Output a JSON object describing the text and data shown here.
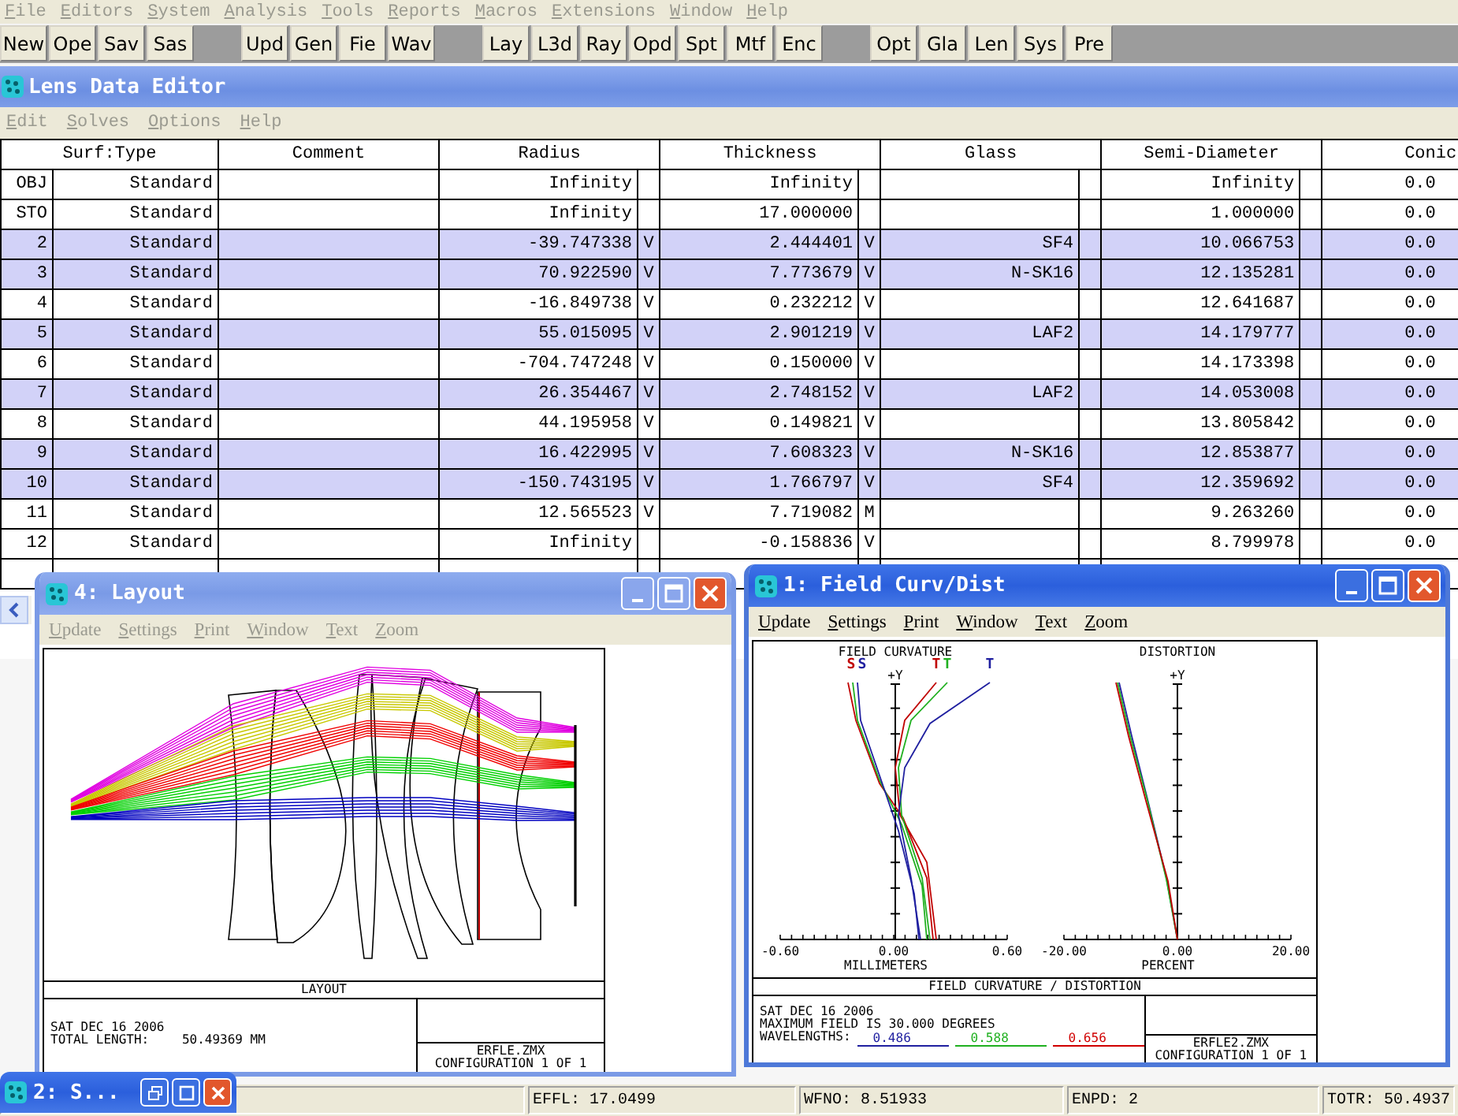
{
  "menu_bar": [
    {
      "label": "File",
      "disabled": true
    },
    {
      "label": "Editors",
      "disabled": true
    },
    {
      "label": "System",
      "disabled": true
    },
    {
      "label": "Analysis",
      "disabled": true
    },
    {
      "label": "Tools",
      "disabled": true
    },
    {
      "label": "Reports",
      "disabled": true
    },
    {
      "label": "Macros",
      "disabled": true
    },
    {
      "label": "Extensions",
      "disabled": true
    },
    {
      "label": "Window",
      "disabled": true
    },
    {
      "label": "Help",
      "disabled": true
    }
  ],
  "toolbar": [
    {
      "buttons": [
        "New",
        "Ope",
        "Sav",
        "Sas"
      ]
    },
    {
      "buttons": [
        "Upd",
        "Gen",
        "Fie",
        "Wav"
      ]
    },
    {
      "buttons": [
        "Lay",
        "L3d",
        "Ray",
        "Opd",
        "Spt",
        "Mtf",
        "Enc"
      ]
    },
    {
      "buttons": [
        "Opt",
        "Gla",
        "Len",
        "Sys",
        "Pre"
      ]
    }
  ],
  "lens_data_editor": {
    "title": "Lens Data Editor",
    "menu": [
      {
        "label": "Edit",
        "disabled": true
      },
      {
        "label": "Solves",
        "disabled": true
      },
      {
        "label": "Options",
        "disabled": true
      },
      {
        "label": "Help",
        "disabled": true
      }
    ],
    "columns": [
      "Surf:Type",
      "Comment",
      "Radius",
      "Thickness",
      "Glass",
      "Semi-Diameter",
      "Conic"
    ],
    "rows": [
      {
        "surf": "OBJ",
        "type": "Standard",
        "radius": "Infinity",
        "thickness": "Infinity",
        "semi_diameter": "Infinity",
        "conic": "0.0",
        "highlighted": false
      },
      {
        "surf": "STO",
        "type": "Standard",
        "radius": "Infinity",
        "thickness": "17.000000",
        "semi_diameter": "1.000000",
        "conic": "0.0",
        "highlighted": false
      },
      {
        "surf": "2",
        "type": "Standard",
        "radius": "-39.747338",
        "radius_solve": "V",
        "thickness": "2.444401",
        "thickness_solve": "V",
        "glass": "SF4",
        "semi_diameter": "10.066753",
        "conic": "0.0",
        "highlighted": true
      },
      {
        "surf": "3",
        "type": "Standard",
        "radius": "70.922590",
        "radius_solve": "V",
        "thickness": "7.773679",
        "thickness_solve": "V",
        "glass": "N-SK16",
        "semi_diameter": "12.135281",
        "conic": "0.0",
        "highlighted": true
      },
      {
        "surf": "4",
        "type": "Standard",
        "radius": "-16.849738",
        "radius_solve": "V",
        "thickness": "0.232212",
        "thickness_solve": "V",
        "semi_diameter": "12.641687",
        "conic": "0.0",
        "highlighted": false
      },
      {
        "surf": "5",
        "type": "Standard",
        "radius": "55.015095",
        "radius_solve": "V",
        "thickness": "2.901219",
        "thickness_solve": "V",
        "glass": "LAF2",
        "semi_diameter": "14.179777",
        "conic": "0.0",
        "highlighted": true
      },
      {
        "surf": "6",
        "type": "Standard",
        "radius": "-704.747248",
        "radius_solve": "V",
        "thickness": "0.150000",
        "thickness_solve": "V",
        "semi_diameter": "14.173398",
        "conic": "0.0",
        "highlighted": false
      },
      {
        "surf": "7",
        "type": "Standard",
        "radius": "26.354467",
        "radius_solve": "V",
        "thickness": "2.748152",
        "thickness_solve": "V",
        "glass": "LAF2",
        "semi_diameter": "14.053008",
        "conic": "0.0",
        "highlighted": true
      },
      {
        "surf": "8",
        "type": "Standard",
        "radius": "44.195958",
        "radius_solve": "V",
        "thickness": "0.149821",
        "thickness_solve": "V",
        "semi_diameter": "13.805842",
        "conic": "0.0",
        "highlighted": false
      },
      {
        "surf": "9",
        "type": "Standard",
        "radius": "16.422995",
        "radius_solve": "V",
        "thickness": "7.608323",
        "thickness_solve": "V",
        "glass": "N-SK16",
        "semi_diameter": "12.853877",
        "conic": "0.0",
        "highlighted": true
      },
      {
        "surf": "10",
        "type": "Standard",
        "radius": "-150.743195",
        "radius_solve": "V",
        "thickness": "1.766797",
        "thickness_solve": "V",
        "glass": "SF4",
        "semi_diameter": "12.359692",
        "conic": "0.0",
        "highlighted": true
      },
      {
        "surf": "11",
        "type": "Standard",
        "radius": "12.565523",
        "radius_solve": "V",
        "thickness": "7.719082",
        "thickness_solve": "M",
        "semi_diameter": "9.263260",
        "conic": "0.0",
        "highlighted": false
      },
      {
        "surf": "12",
        "type": "Standard",
        "radius": "Infinity",
        "thickness": "-0.158836",
        "thickness_solve": "V",
        "semi_diameter": "8.799978",
        "conic": "0.0",
        "highlighted": false
      }
    ]
  },
  "layout_window": {
    "title": "4: Layout",
    "active": false,
    "menu": [
      {
        "label": "Update",
        "disabled": true
      },
      {
        "label": "Settings",
        "disabled": true
      },
      {
        "label": "Print",
        "disabled": true
      },
      {
        "label": "Window",
        "disabled": true
      },
      {
        "label": "Text",
        "disabled": true
      },
      {
        "label": "Zoom",
        "disabled": true
      }
    ],
    "plot_title": "LAYOUT",
    "date": "SAT DEC 16 2006",
    "total_length_label": "TOTAL LENGTH:",
    "total_length": "50.49369 MM",
    "file": "ERFLE.ZMX",
    "configuration": "CONFIGURATION 1 OF 1"
  },
  "field_window": {
    "title": "1: Field Curv/Dist",
    "active": true,
    "menu": [
      {
        "label": "Update",
        "disabled": false
      },
      {
        "label": "Settings",
        "disabled": false
      },
      {
        "label": "Print",
        "disabled": false
      },
      {
        "label": "Window",
        "disabled": false
      },
      {
        "label": "Text",
        "disabled": false
      },
      {
        "label": "Zoom",
        "disabled": false
      }
    ],
    "charts": [
      {
        "title": "FIELD CURVATURE",
        "axis_label": "+Y",
        "ticks": [
          "-0.60",
          "0.00",
          "0.60"
        ],
        "xlabel": "MILLIMETERS"
      },
      {
        "title": "DISTORTION",
        "axis_label": "+Y",
        "ticks": [
          "-20.00",
          "0.00",
          "20.00"
        ],
        "xlabel": "PERCENT"
      }
    ],
    "curve_labels": [
      {
        "text": "S",
        "color": "#c00000"
      },
      {
        "text": "S",
        "color": "#2020a0"
      },
      {
        "text": "T",
        "color": "#c00000"
      },
      {
        "text": "T",
        "color": "#20b020"
      },
      {
        "text": "T",
        "color": "#2020a0"
      }
    ],
    "plot_title": "FIELD CURVATURE / DISTORTION",
    "date": "SAT DEC 16 2006",
    "max_field": "MAXIMUM FIELD IS 30.000 DEGREES",
    "wavelengths_label": "WAVELENGTHS:",
    "wavelengths": [
      {
        "value": "0.486",
        "color": "#2020a0"
      },
      {
        "value": "0.588",
        "color": "#20b020"
      },
      {
        "value": "0.656",
        "color": "#d00000"
      }
    ],
    "file": "ERFLE2.ZMX",
    "configuration": "CONFIGURATION 1 OF 1"
  },
  "minimized_window": {
    "title": "2: S..."
  },
  "status_bar": [
    "EFFL: 17.0499",
    "WFNO: 8.51933",
    "ENPD: 2",
    "TOTR: 50.4937"
  ]
}
